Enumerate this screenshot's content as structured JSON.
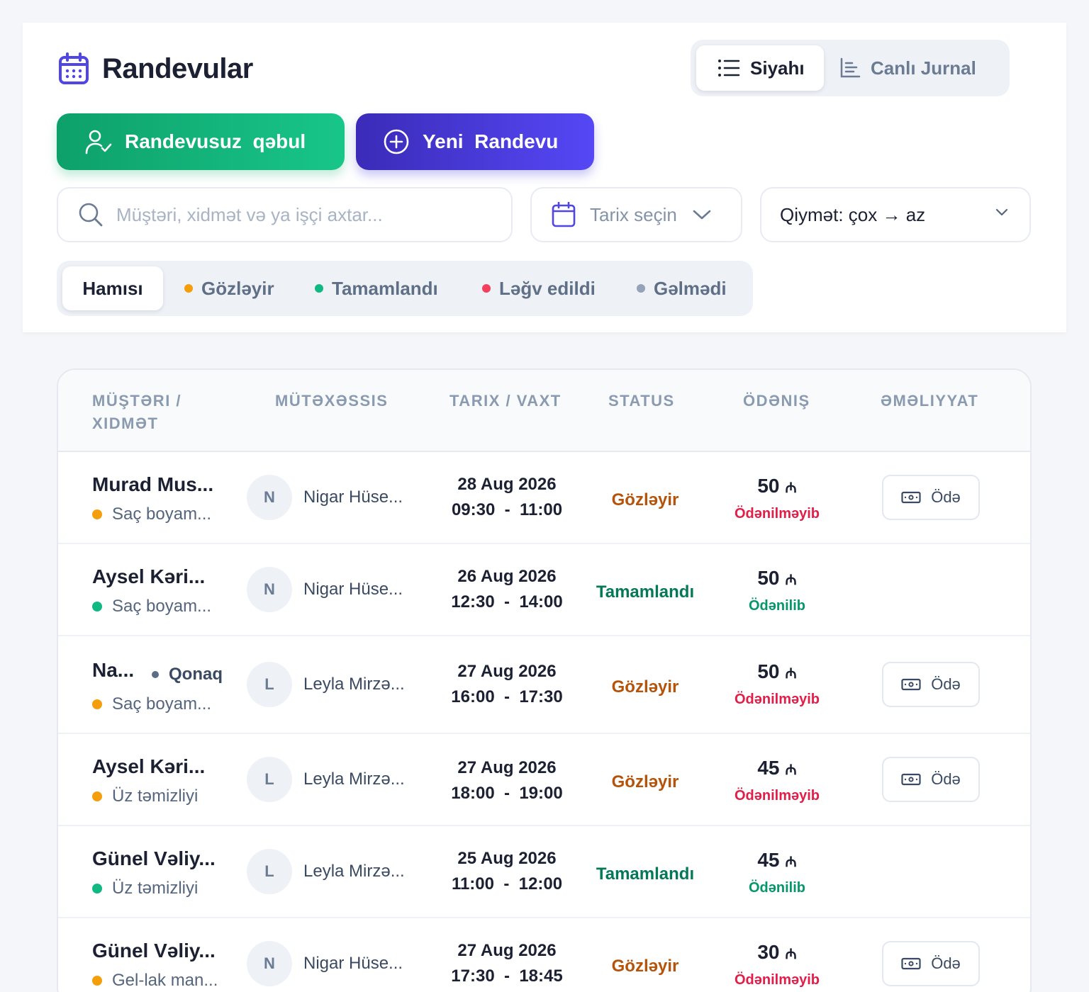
{
  "header": {
    "title": "Randevular",
    "title_icon": "calendar-icon",
    "view_toggle": {
      "list_label": "Siyahı",
      "journal_label": "Canlı Jurnal"
    },
    "walkin_button": "Randevusuz  qəbul",
    "new_button": "Yeni  Randevu"
  },
  "filters": {
    "search_placeholder": "Müştəri, xidmət və ya işçi axtar...",
    "date_placeholder": "Tarix seçin",
    "sort_label": "Qiymət: çox → az"
  },
  "status_tabs": [
    {
      "label": "Hamısı",
      "color": ""
    },
    {
      "label": "Gözləyir",
      "color": "#f59e0b"
    },
    {
      "label": "Tamamlandı",
      "color": "#10b981"
    },
    {
      "label": "Ləğv edildi",
      "color": "#f43f5e"
    },
    {
      "label": "Gəlmədi",
      "color": "#94a3b8"
    }
  ],
  "table": {
    "columns": [
      "Müştəri / Xidmət",
      "Mütəxəssis",
      "Tarix / Vaxt",
      "Status",
      "Ödəniş",
      "Əməliyyat"
    ],
    "currency_symbol": "₼",
    "pay_action_label": "Ödə",
    "rows": [
      {
        "client": "Murad Mus...",
        "guest": "",
        "service": "Saç boyam...",
        "initial": "N",
        "specialist": "Nigar Hüse...",
        "date": "28 Aug 2026",
        "time": "09:30  -  11:00",
        "status": "Gözləyir",
        "amount": "50",
        "payment": "Ödənilməyib"
      },
      {
        "client": "Aysel Kəri...",
        "guest": "",
        "service": "Saç boyam...",
        "initial": "N",
        "specialist": "Nigar Hüse...",
        "date": "26 Aug 2026",
        "time": "12:30  -  14:00",
        "status": "Tamamlandı",
        "amount": "50",
        "payment": "Ödənilib"
      },
      {
        "client": "Na...",
        "guest": "Qonaq",
        "service": "Saç boyam...",
        "initial": "L",
        "specialist": "Leyla Mirzə...",
        "date": "27 Aug 2026",
        "time": "16:00  -  17:30",
        "status": "Gözləyir",
        "amount": "50",
        "payment": "Ödənilməyib"
      },
      {
        "client": "Aysel Kəri...",
        "guest": "",
        "service": "Üz təmizliyi",
        "initial": "L",
        "specialist": "Leyla Mirzə...",
        "date": "27 Aug 2026",
        "time": "18:00  -  19:00",
        "status": "Gözləyir",
        "amount": "45",
        "payment": "Ödənilməyib"
      },
      {
        "client": "Günel Vəliy...",
        "guest": "",
        "service": "Üz təmizliyi",
        "initial": "L",
        "specialist": "Leyla Mirzə...",
        "date": "25 Aug 2026",
        "time": "11:00  -  12:00",
        "status": "Tamamlandı",
        "amount": "45",
        "payment": "Ödənilib"
      },
      {
        "client": "Günel Vəliy...",
        "guest": "",
        "service": "Gel-lak man...",
        "initial": "N",
        "specialist": "Nigar Hüse...",
        "date": "27 Aug 2026",
        "time": "17:30  -  18:45",
        "status": "Gözləyir",
        "amount": "30",
        "payment": "Ödənilməyib"
      }
    ]
  },
  "colors": {
    "pending": "#b45309",
    "completed": "#047857",
    "unpaid": "#e11d48",
    "paid": "#059669",
    "dot_pending": "#f59e0b",
    "dot_completed": "#10b981"
  }
}
